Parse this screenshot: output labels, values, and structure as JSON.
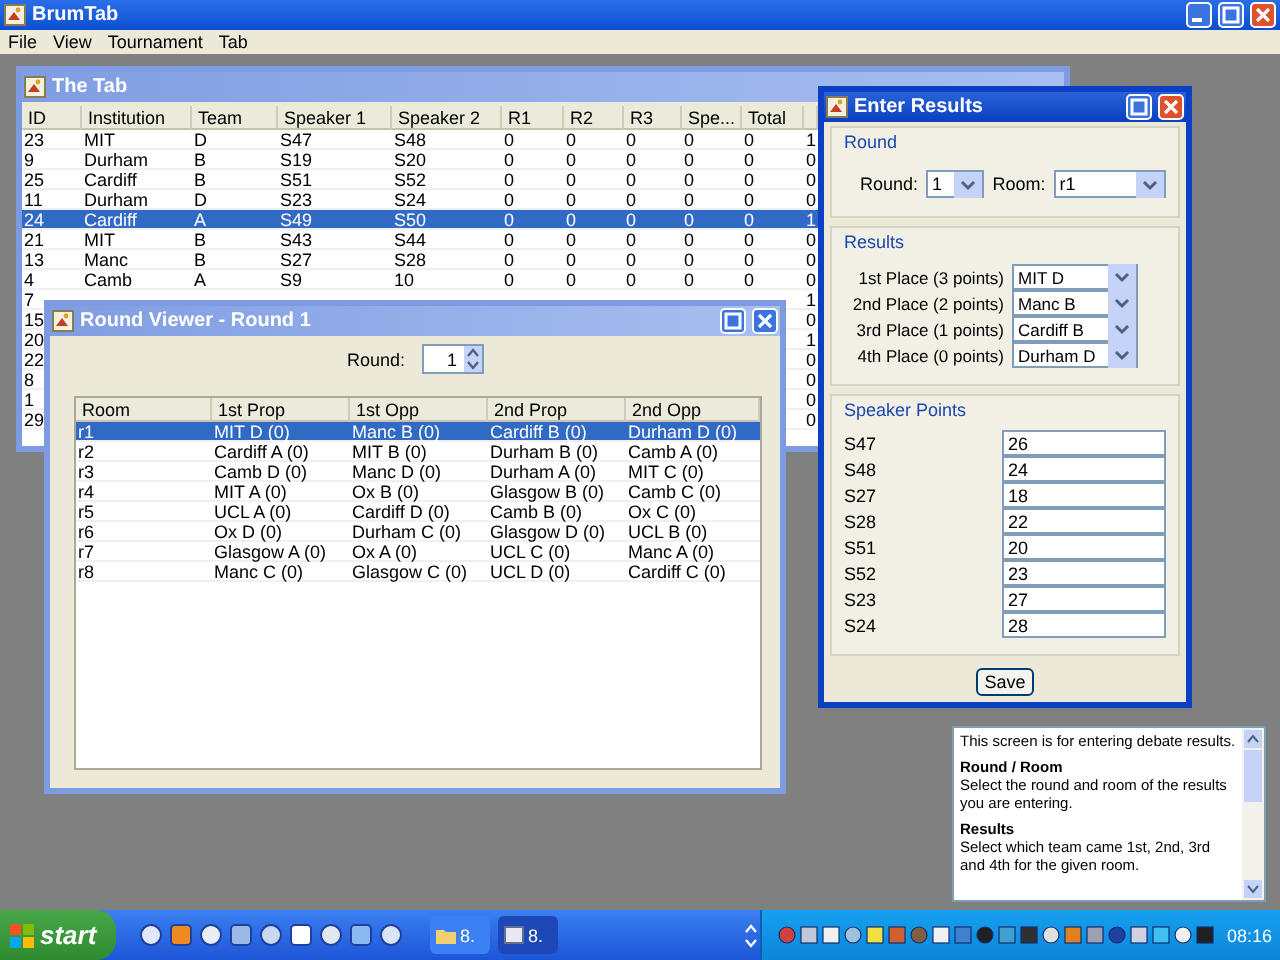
{
  "window": {
    "title": "BrumTab"
  },
  "menu": [
    "File",
    "View",
    "Tournament",
    "Tab"
  ],
  "tab_window": {
    "title": "The Tab",
    "active": false,
    "columns": [
      "ID",
      "Institution",
      "Team",
      "Speaker 1",
      "Speaker 2",
      "R1",
      "R2",
      "R3",
      "Spe...",
      "Total"
    ],
    "rows": [
      {
        "id": "23",
        "cells": [
          "MIT",
          "D",
          "S47",
          "S48",
          "0",
          "0",
          "0",
          "0",
          "0"
        ],
        "column_11": "1",
        "selected": false
      },
      {
        "id": "9",
        "cells": [
          "Durham",
          "B",
          "S19",
          "S20",
          "0",
          "0",
          "0",
          "0",
          "0"
        ],
        "column_11": "0",
        "selected": false
      },
      {
        "id": "25",
        "cells": [
          "Cardiff",
          "B",
          "S51",
          "S52",
          "0",
          "0",
          "0",
          "0",
          "0"
        ],
        "column_11": "0",
        "selected": false
      },
      {
        "id": "11",
        "cells": [
          "Durham",
          "D",
          "S23",
          "S24",
          "0",
          "0",
          "0",
          "0",
          "0"
        ],
        "column_11": "0",
        "selected": false
      },
      {
        "id": "24",
        "cells": [
          "Cardiff",
          "A",
          "S49",
          "S50",
          "0",
          "0",
          "0",
          "0",
          "0"
        ],
        "column_11": "1",
        "selected": true
      },
      {
        "id": "21",
        "cells": [
          "MIT",
          "B",
          "S43",
          "S44",
          "0",
          "0",
          "0",
          "0",
          "0"
        ],
        "column_11": "0",
        "selected": false
      },
      {
        "id": "13",
        "cells": [
          "Manc",
          "B",
          "S27",
          "S28",
          "0",
          "0",
          "0",
          "0",
          "0"
        ],
        "column_11": "0",
        "selected": false
      },
      {
        "id": "4",
        "cells": [
          "Camb",
          "A",
          "S9",
          "10",
          "0",
          "0",
          "0",
          "0",
          "0"
        ],
        "column_11": "0",
        "selected": false
      },
      {
        "id": "7",
        "column_11": "1",
        "selected": false
      },
      {
        "id": "15",
        "column_11": "0",
        "selected": false
      },
      {
        "id": "20",
        "column_11": "1",
        "selected": false
      },
      {
        "id": "22",
        "column_11": "0",
        "selected": false
      },
      {
        "id": "8",
        "column_11": "0",
        "selected": false
      },
      {
        "id": "1",
        "column_11": "0",
        "selected": false
      },
      {
        "id": "29",
        "column_11": "0",
        "selected": false
      }
    ]
  },
  "round_viewer": {
    "title": "Round Viewer - Round 1",
    "active": false,
    "round_label": "Round:",
    "round_value": "1",
    "columns": [
      "Room",
      "1st Prop",
      "1st Opp",
      "2nd Prop",
      "2nd Opp"
    ],
    "rows": [
      {
        "cells": [
          "r1",
          "MIT D (0)",
          "Manc B (0)",
          "Cardiff B (0)",
          "Durham D (0)"
        ],
        "selected": true
      },
      {
        "cells": [
          "r2",
          "Cardiff A (0)",
          "MIT B (0)",
          "Durham B (0)",
          "Camb A (0)"
        ],
        "selected": false
      },
      {
        "cells": [
          "r3",
          "Camb D (0)",
          "Manc D (0)",
          "Durham A (0)",
          "MIT C (0)"
        ],
        "selected": false
      },
      {
        "cells": [
          "r4",
          "MIT A (0)",
          "Ox B (0)",
          "Glasgow B (0)",
          "Camb C (0)"
        ],
        "selected": false
      },
      {
        "cells": [
          "r5",
          "UCL A (0)",
          "Cardiff D (0)",
          "Camb B (0)",
          "Ox C (0)"
        ],
        "selected": false
      },
      {
        "cells": [
          "r6",
          "Ox D (0)",
          "Durham C (0)",
          "Glasgow D (0)",
          "UCL B (0)"
        ],
        "selected": false
      },
      {
        "cells": [
          "r7",
          "Glasgow A (0)",
          "Ox A (0)",
          "UCL C (0)",
          "Manc A (0)"
        ],
        "selected": false
      },
      {
        "cells": [
          "r8",
          "Manc C (0)",
          "Glasgow C (0)",
          "UCL D (0)",
          "Cardiff C (0)"
        ],
        "selected": false
      }
    ]
  },
  "enter_results": {
    "title": "Enter Results",
    "active": true,
    "round_group": "Round",
    "round_label": "Round:",
    "round_value": "1",
    "room_label": "Room:",
    "room_value": "r1",
    "results_group": "Results",
    "places": [
      {
        "label": "1st Place (3 points)",
        "value": "MIT D"
      },
      {
        "label": "2nd Place (2 points)",
        "value": "Manc B"
      },
      {
        "label": "3rd Place (1 points)",
        "value": "Cardiff B"
      },
      {
        "label": "4th Place (0 points)",
        "value": "Durham D"
      }
    ],
    "speaker_group": "Speaker Points",
    "speakers": [
      {
        "label": "S47",
        "value": "26"
      },
      {
        "label": "S48",
        "value": "24"
      },
      {
        "label": "S27",
        "value": "18"
      },
      {
        "label": "S28",
        "value": "22"
      },
      {
        "label": "S51",
        "value": "20"
      },
      {
        "label": "S52",
        "value": "23"
      },
      {
        "label": "S23",
        "value": "27"
      },
      {
        "label": "S24",
        "value": "28"
      }
    ],
    "save": "Save"
  },
  "help": [
    {
      "kind": "text",
      "text": "This screen is for entering debate results."
    },
    {
      "kind": "heading",
      "text": "Round / Room"
    },
    {
      "kind": "text",
      "text": "Select the round and room of the results you are entering."
    },
    {
      "kind": "heading",
      "text": "Results"
    },
    {
      "kind": "text",
      "text": "Select which team came 1st, 2nd, 3rd and 4th for the given room."
    }
  ],
  "taskbar": {
    "start": "start",
    "tasks": [
      {
        "label": "8.",
        "selected": false
      },
      {
        "label": "8.",
        "selected": true
      }
    ],
    "clock": "08:16"
  }
}
